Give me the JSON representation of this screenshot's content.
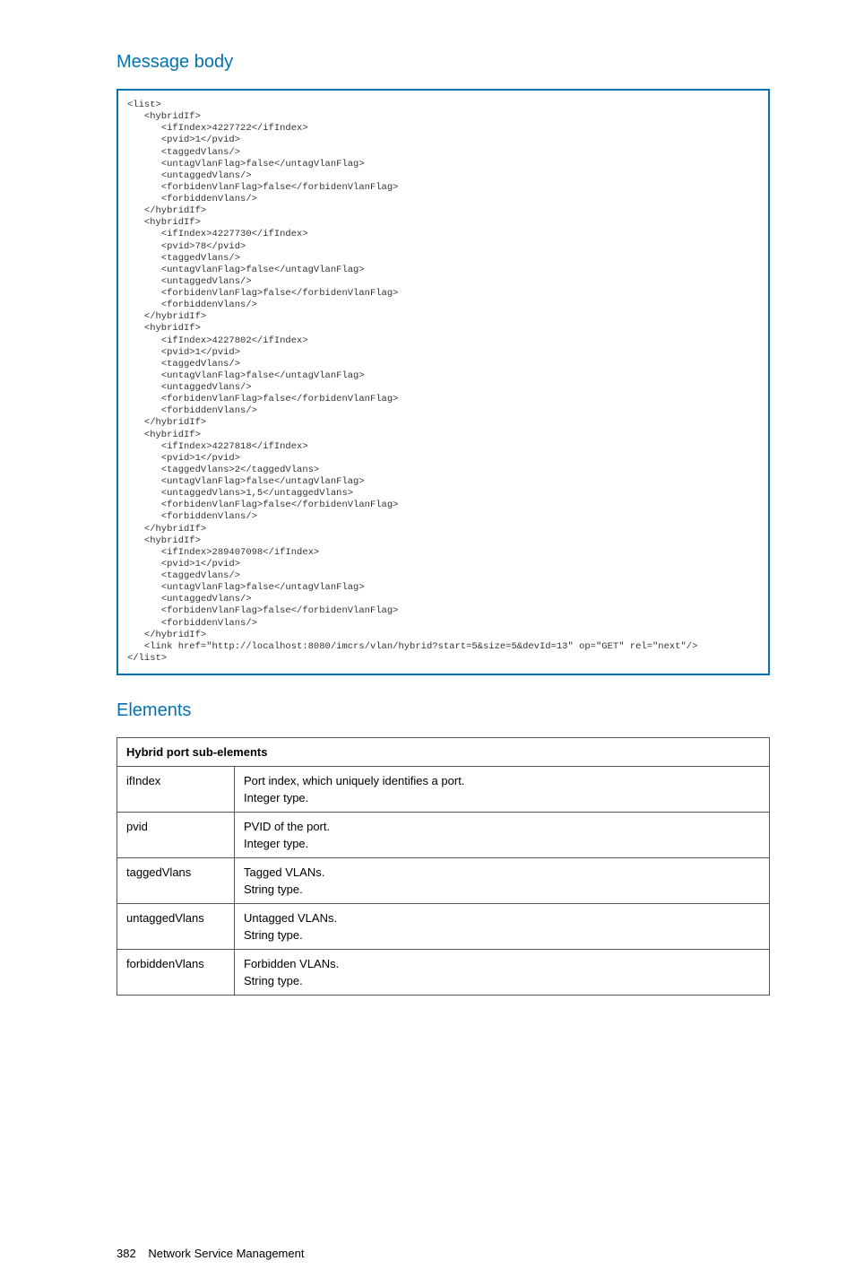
{
  "headings": {
    "message_body": "Message body",
    "elements": "Elements"
  },
  "code": "<list>\n   <hybridIf>\n      <ifIndex>4227722</ifIndex>\n      <pvid>1</pvid>\n      <taggedVlans/>\n      <untagVlanFlag>false</untagVlanFlag>\n      <untaggedVlans/>\n      <forbidenVlanFlag>false</forbidenVlanFlag>\n      <forbiddenVlans/>\n   </hybridIf>\n   <hybridIf>\n      <ifIndex>4227730</ifIndex>\n      <pvid>78</pvid>\n      <taggedVlans/>\n      <untagVlanFlag>false</untagVlanFlag>\n      <untaggedVlans/>\n      <forbidenVlanFlag>false</forbidenVlanFlag>\n      <forbiddenVlans/>\n   </hybridIf>\n   <hybridIf>\n      <ifIndex>4227802</ifIndex>\n      <pvid>1</pvid>\n      <taggedVlans/>\n      <untagVlanFlag>false</untagVlanFlag>\n      <untaggedVlans/>\n      <forbidenVlanFlag>false</forbidenVlanFlag>\n      <forbiddenVlans/>\n   </hybridIf>\n   <hybridIf>\n      <ifIndex>4227818</ifIndex>\n      <pvid>1</pvid>\n      <taggedVlans>2</taggedVlans>\n      <untagVlanFlag>false</untagVlanFlag>\n      <untaggedVlans>1,5</untaggedVlans>\n      <forbidenVlanFlag>false</forbidenVlanFlag>\n      <forbiddenVlans/>\n   </hybridIf>\n   <hybridIf>\n      <ifIndex>289407098</ifIndex>\n      <pvid>1</pvid>\n      <taggedVlans/>\n      <untagVlanFlag>false</untagVlanFlag>\n      <untaggedVlans/>\n      <forbidenVlanFlag>false</forbidenVlanFlag>\n      <forbiddenVlans/>\n   </hybridIf>\n   <link href=\"http://localhost:8080/imcrs/vlan/hybrid?start=5&size=5&devId=13\" op=\"GET\" rel=\"next\"/>\n</list>",
  "table": {
    "header": "Hybrid port sub-elements",
    "rows": [
      {
        "name": "ifIndex",
        "line1": "Port index, which uniquely identifies a port.",
        "line2": "Integer type."
      },
      {
        "name": "pvid",
        "line1": "PVID of the port.",
        "line2": "Integer type."
      },
      {
        "name": "taggedVlans",
        "line1": "Tagged VLANs.",
        "line2": "String type."
      },
      {
        "name": "untaggedVlans",
        "line1": "Untagged VLANs.",
        "line2": "String type."
      },
      {
        "name": "forbiddenVlans",
        "line1": "Forbidden VLANs.",
        "line2": "String type."
      }
    ]
  },
  "footer": {
    "page": "382",
    "text": "Network Service Management"
  }
}
